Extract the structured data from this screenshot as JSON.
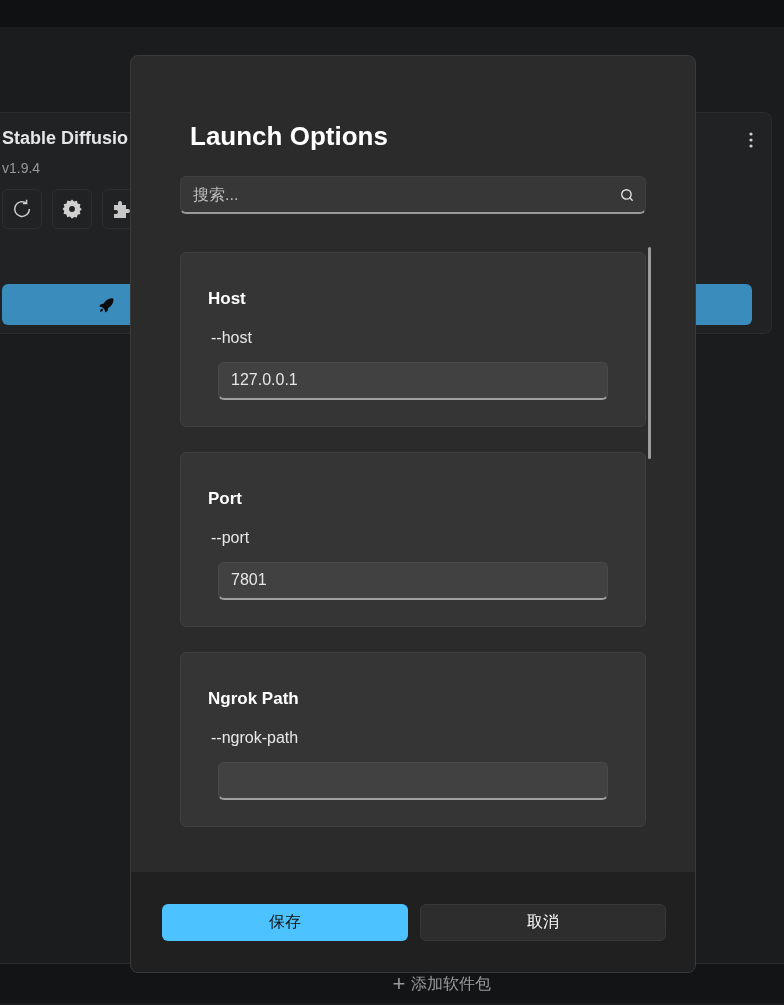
{
  "background": {
    "package_card": {
      "title": "Stable Diffusio",
      "version": "v1.9.4"
    },
    "add_package": {
      "icon": "+",
      "label": "添加软件包"
    }
  },
  "dialog": {
    "title": "Launch Options",
    "search": {
      "placeholder": "搜索..."
    },
    "options": [
      {
        "label": "Host",
        "flag": "--host",
        "value": "127.0.0.1"
      },
      {
        "label": "Port",
        "flag": "--port",
        "value": "7801"
      },
      {
        "label": "Ngrok Path",
        "flag": "--ngrok-path"
      }
    ],
    "buttons": [
      {
        "label": "保存",
        "kind": "primary"
      },
      {
        "label": "取消",
        "kind": "secondary"
      }
    ]
  }
}
